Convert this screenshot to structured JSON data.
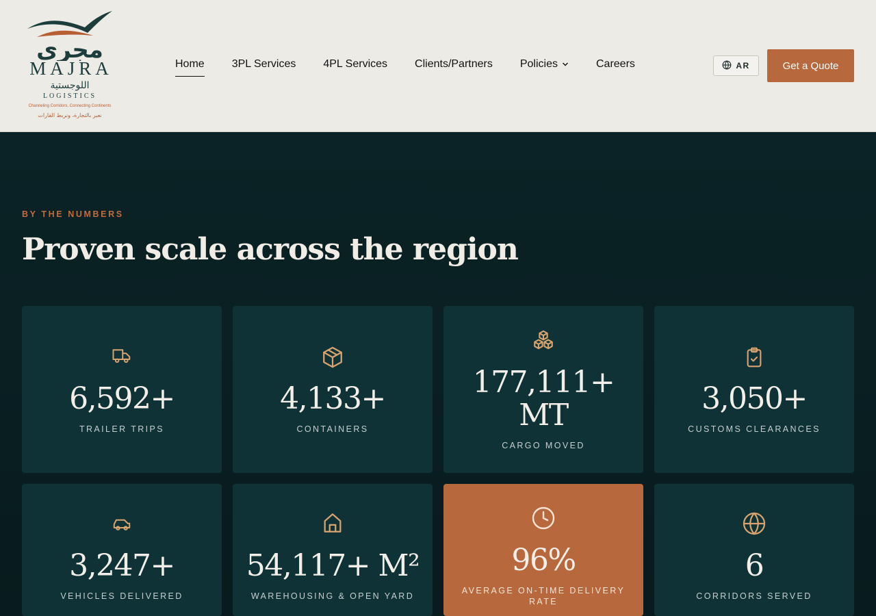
{
  "brand": {
    "name_arabic": "مجرى",
    "name_latin": "MAJRA",
    "sub_arabic": "اللوجستية",
    "sub_latin": "LOGISTICS",
    "tagline": "Channeling Corridors, Connecting Continents",
    "tagline_arabic": "نعبر بالتجارة، ونربط القارات",
    "colors": {
      "teal": "#1c3d3c",
      "orange": "#b75e34"
    }
  },
  "nav": {
    "items": [
      {
        "label": "Home",
        "active": true
      },
      {
        "label": "3PL Services"
      },
      {
        "label": "4PL Services"
      },
      {
        "label": "Clients/Partners"
      },
      {
        "label": "Policies",
        "has_dropdown": true
      },
      {
        "label": "Careers"
      }
    ],
    "lang_label": "AR",
    "quote_label": "Get a Quote"
  },
  "section": {
    "eyebrow": "BY THE NUMBERS",
    "title": "Proven scale across the region"
  },
  "stats": [
    {
      "icon": "truck-icon",
      "value": "6,592+",
      "label": "TRAILER TRIPS"
    },
    {
      "icon": "box-icon",
      "value": "4,133+",
      "label": "CONTAINERS"
    },
    {
      "icon": "boxes-icon",
      "value_line1": "177,111+",
      "value_line2": "MT",
      "label": "CARGO MOVED"
    },
    {
      "icon": "clipboard-check-icon",
      "value": "3,050+",
      "label": "CUSTOMS CLEARANCES"
    },
    {
      "icon": "car-icon",
      "value": "3,247+",
      "label": "VEHICLES DELIVERED"
    },
    {
      "icon": "warehouse-icon",
      "value": "54,117+ M²",
      "label": "WAREHOUSING & OPEN YARD"
    },
    {
      "icon": "clock-icon",
      "value": "96%",
      "label_line1": "AVERAGE ON-TIME DELIVERY",
      "label_line2": "RATE",
      "highlighted": true
    },
    {
      "icon": "globe-icon",
      "value": "6",
      "label": "CORRIDORS SERVED"
    }
  ],
  "colors": {
    "accent": "#b7693d",
    "card": "#0f3236",
    "background": "#0b2124",
    "header": "#edebe6",
    "icon": "#d8a36f"
  }
}
